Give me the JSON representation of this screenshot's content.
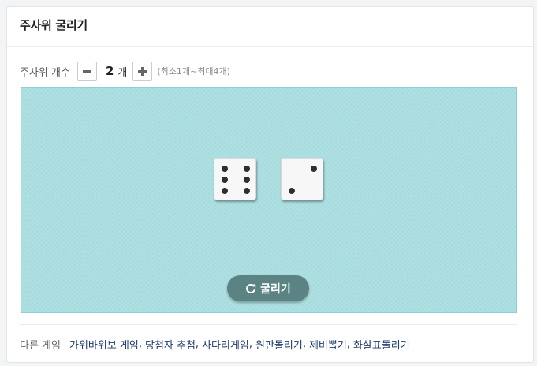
{
  "header": {
    "title": "주사위 굴리기"
  },
  "dice_count": {
    "label": "주사위 개수",
    "value": "2",
    "unit": "개",
    "hint": "(최소1개~최대4개)",
    "decrement_icon": "minus-icon",
    "increment_icon": "plus-icon"
  },
  "board": {
    "background_color": "#a7dcdf",
    "dice": [
      {
        "face": 6
      },
      {
        "face": 2
      }
    ]
  },
  "roll_button": {
    "label": "굴리기",
    "icon": "refresh-icon",
    "color": "#5b8383"
  },
  "other_games": {
    "label": "다른 게임",
    "links": [
      "가위바위보 게임",
      "당첨자 추첨",
      "사다리게임",
      "원판돌리기",
      "제비뽑기",
      "화살표돌리기"
    ]
  }
}
